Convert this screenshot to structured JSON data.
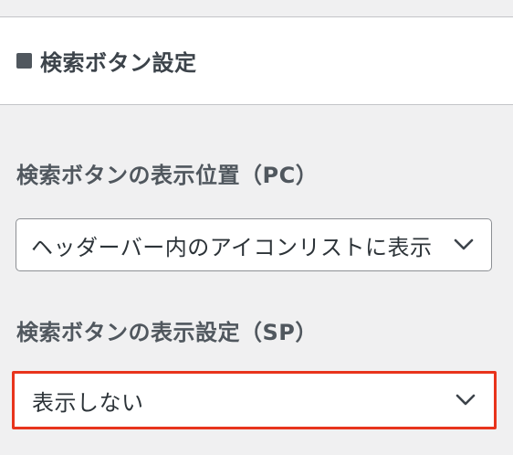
{
  "section": {
    "title": "検索ボタン設定"
  },
  "fields": {
    "pc_label": "検索ボタンの表示位置（PC）",
    "pc_value": "ヘッダーバー内のアイコンリストに表示",
    "sp_label": "検索ボタンの表示設定（SP）",
    "sp_value": "表示しない"
  },
  "colors": {
    "highlight_border": "#e8341c",
    "panel_background": "#f0f0f1",
    "header_background": "#ffffff"
  },
  "icons": {
    "section_marker": "square-icon",
    "dropdown_indicator": "chevron-down-icon"
  }
}
